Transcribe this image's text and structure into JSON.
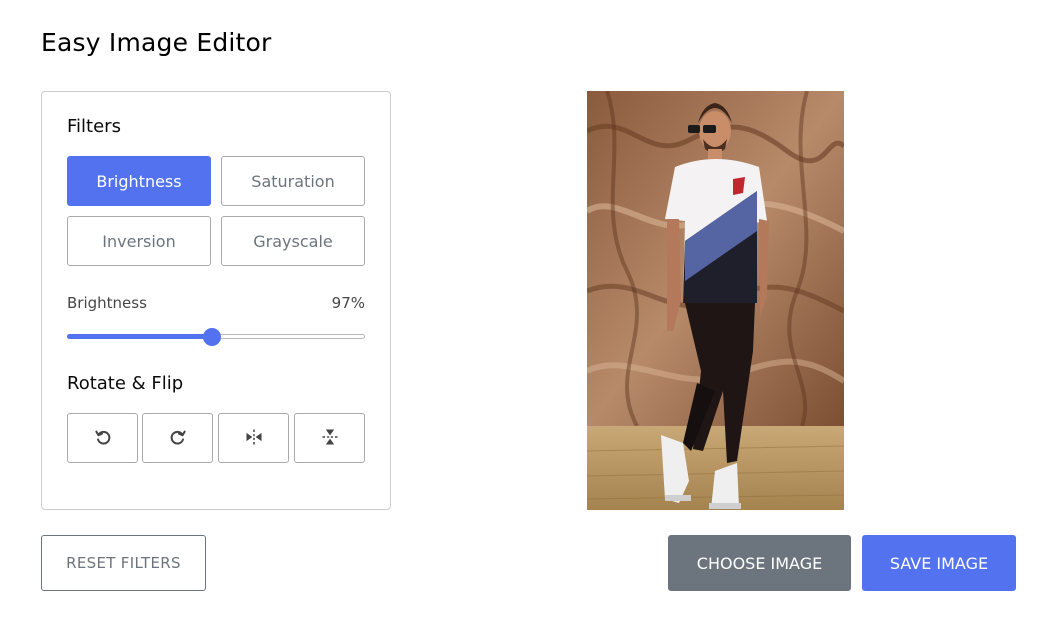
{
  "app": {
    "title": "Easy Image Editor"
  },
  "filters": {
    "heading": "Filters",
    "buttons": [
      {
        "label": "Brightness",
        "active": true
      },
      {
        "label": "Saturation",
        "active": false
      },
      {
        "label": "Inversion",
        "active": false
      },
      {
        "label": "Grayscale",
        "active": false
      }
    ]
  },
  "slider": {
    "label": "Brightness",
    "value_text": "97%",
    "value": 97,
    "max": 200
  },
  "rotate_flip": {
    "heading": "Rotate & Flip",
    "buttons": [
      {
        "icon": "rotate-left-icon"
      },
      {
        "icon": "rotate-right-icon"
      },
      {
        "icon": "flip-horizontal-icon"
      },
      {
        "icon": "flip-vertical-icon"
      }
    ]
  },
  "actions": {
    "reset": "RESET FILTERS",
    "choose": "CHOOSE IMAGE",
    "save": "SAVE IMAGE"
  },
  "colors": {
    "accent": "#5372f0",
    "secondary": "#6c757d"
  }
}
